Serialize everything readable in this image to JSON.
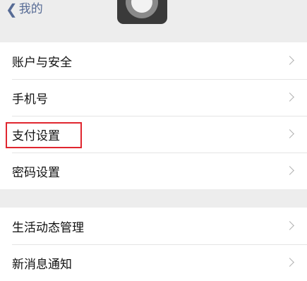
{
  "header": {
    "back_label": "我的"
  },
  "sections": [
    {
      "items": [
        {
          "label": "账户与安全"
        },
        {
          "label": "手机号"
        },
        {
          "label": "支付设置"
        },
        {
          "label": "密码设置"
        }
      ]
    },
    {
      "items": [
        {
          "label": "生活动态管理"
        },
        {
          "label": "新消息通知"
        }
      ]
    }
  ],
  "icons": {
    "back": "chevron-left-icon",
    "row_arrow": "chevron-right-icon",
    "assistive_touch": "assistive-touch-icon"
  },
  "colors": {
    "background": "#ededed",
    "card": "#ffffff",
    "back_link": "#576b95",
    "highlight_border": "#e0262f"
  }
}
